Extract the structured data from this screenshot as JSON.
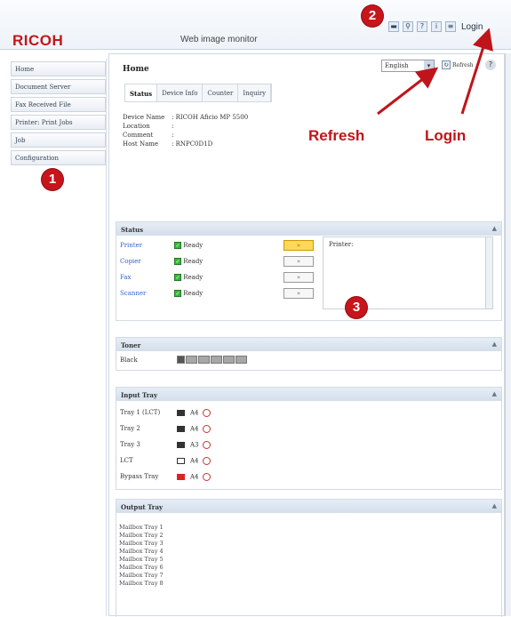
{
  "header": {
    "logo": "RICOH",
    "subtitle": "Web image monitor",
    "login_label": "Login",
    "icons": [
      "minimize-icon",
      "search-icon",
      "help-icon",
      "info-icon",
      "login-icon"
    ]
  },
  "sidebar": {
    "items": [
      {
        "label": "Home"
      },
      {
        "label": "Document Server"
      },
      {
        "label": "Fax Received File"
      },
      {
        "label": "Printer: Print Jobs"
      },
      {
        "label": "Job"
      },
      {
        "label": "Configuration"
      }
    ]
  },
  "main": {
    "title": "Home",
    "language": "English",
    "refresh_label": "Refresh",
    "tabs": [
      {
        "label": "Status"
      },
      {
        "label": "Device Info"
      },
      {
        "label": "Counter"
      },
      {
        "label": "Inquiry"
      }
    ],
    "device_info": [
      {
        "label": "Device Name",
        "value": ": RICOH Aficio MP 5500"
      },
      {
        "label": "Location",
        "value": ":"
      },
      {
        "label": "Comment",
        "value": ":"
      },
      {
        "label": "Host Name",
        "value": ": RNPC0D1D"
      }
    ]
  },
  "status": {
    "title": "Status",
    "rows": [
      {
        "name": "Printer",
        "state": "Ready"
      },
      {
        "name": "Copier",
        "state": "Ready"
      },
      {
        "name": "Fax",
        "state": "Ready"
      },
      {
        "name": "Scanner",
        "state": "Ready"
      }
    ],
    "printer_label": "Printer:"
  },
  "toner": {
    "title": "Toner",
    "color": "Black",
    "level": 0.9
  },
  "input_tray": {
    "title": "Input Tray",
    "rows": [
      {
        "name": "Tray 1 (LCT)",
        "size": "A4"
      },
      {
        "name": "Tray 2",
        "size": "A4"
      },
      {
        "name": "Tray 3",
        "size": "A3"
      },
      {
        "name": "LCT",
        "size": "A4"
      },
      {
        "name": "Bypass Tray",
        "size": "A4"
      }
    ]
  },
  "output_tray": {
    "title": "Output Tray",
    "rows": [
      "Mailbox Tray 1",
      "Mailbox Tray 2",
      "Mailbox Tray 3",
      "Mailbox Tray 4",
      "Mailbox Tray 5",
      "Mailbox Tray 6",
      "Mailbox Tray 7",
      "Mailbox Tray 8"
    ]
  },
  "annotations": {
    "circle1": "1",
    "circle2": "2",
    "circle3": "3",
    "refresh": "Refresh",
    "login": "Login"
  },
  "colors": {
    "brand": "#c4161c",
    "annotation": "#c0141b",
    "ready": "#33bb33",
    "header_bar": "#d4dfec"
  }
}
